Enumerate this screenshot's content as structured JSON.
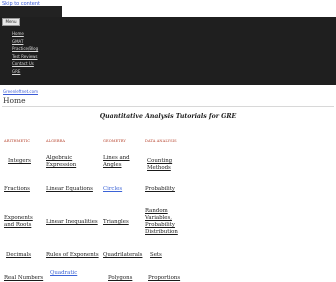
{
  "skip_link": "Skip to content",
  "menu_button": "Menu",
  "nav": {
    "items": [
      {
        "label": "Home"
      },
      {
        "label": "GMAT"
      },
      {
        "label": "Practice/Blog"
      },
      {
        "label": "Test Reviews"
      },
      {
        "label": "Contact Us"
      },
      {
        "label": "GRE"
      }
    ]
  },
  "site_link": "Greenleftnet.com",
  "breadcrumb": "Home",
  "page_heading": "Quantitative Analysis Tutorials for GRE",
  "columns": {
    "arithmetic": "ARITHMETIC",
    "algebra": "ALGEBRA",
    "geometry": "GEOMETRY",
    "data_analysis": "DATA ANALYSIS"
  },
  "topics": {
    "integers": "Integers",
    "algebraic_expression": "Algebraic Expression",
    "lines_angles": "Lines and Angles",
    "counting_methods": "Counting Methods",
    "fractions": "Fractions",
    "linear_equations": "Linear Equations",
    "circles": "Circles",
    "probability": "Probability",
    "exponents_roots": "Exponents and Roots",
    "linear_inequalities": "Linear Inequalities",
    "triangles": "Triangles",
    "random_variables": "Random Variables, Probability Distribution",
    "decimals": "Decimals",
    "rules_of_exponents": "Rules of Exponents",
    "quadrilaterals": "Quadrilaterals",
    "sets": "Sets",
    "real_numbers": "Real Numbers",
    "quadratic": "Quadratic",
    "polygons": "Polygons",
    "proportions": "Proportions"
  },
  "colors": {
    "dark_band": "#1f1f1f",
    "column_heading": "#b5402a",
    "link_blue": "#3b63d6"
  }
}
